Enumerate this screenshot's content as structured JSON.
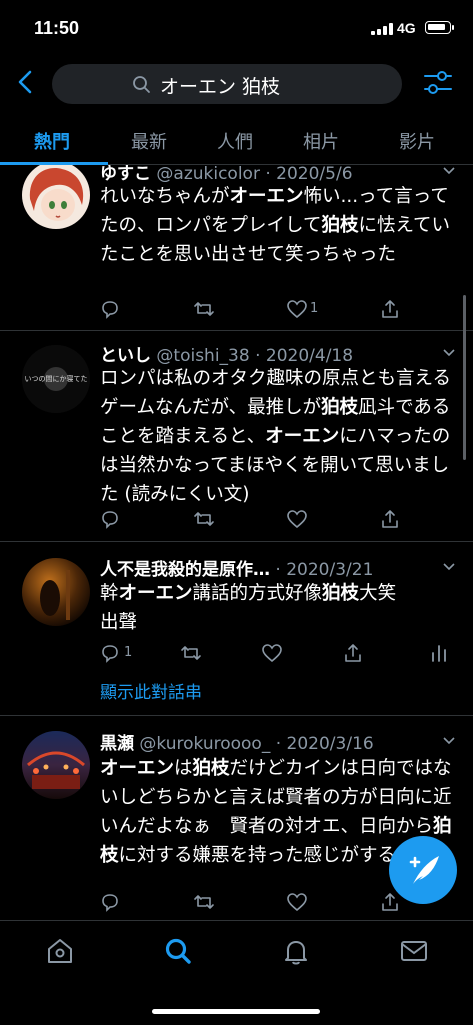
{
  "status": {
    "time": "11:50",
    "network": "4G"
  },
  "header": {
    "query": "オーエン 狛枝"
  },
  "tabs": [
    "熱門",
    "最新",
    "人們",
    "相片",
    "影片"
  ],
  "tweets": [
    {
      "name": "ゆすこ",
      "meta": "@azukicolor · 2020/5/6",
      "body": "れいなちゃんがオーエン怖い...って言ってたの、ロンパをプレイして狛枝に怯えていたことを思い出させて笑っちゃった",
      "like_count": "1"
    },
    {
      "name": "といし",
      "meta": "@toishi_38 · 2020/4/18",
      "avatar_text": "いつの間にか寝てた",
      "body": "ロンパは私のオタク趣味の原点とも言えるゲームなんだが、最推しが狛枝凪斗であることを踏まえると、オーエンにハマったのは当然かなってまほやくを開いて思いました (読みにくい文)"
    },
    {
      "name": "人不是我殺的是原作…",
      "meta": "· 2020/3/21",
      "body": "幹オーエン講話的方式好像狛枝大笑出聲",
      "reply_count": "1",
      "thread": "顯示此對話串"
    },
    {
      "name": "黒瀬",
      "meta": "@kurokuroooo_ · 2020/3/16",
      "body": "オーエンは狛枝だけどカインは日向ではないしどちらかと言えば賢者の方が日向に近いんだよなぁ　賢者の対オエ、日向から狛枝に対する嫌悪を持った感じがする　アイランド日向"
    }
  ],
  "icons": {
    "back": "back-arrow-icon",
    "search": "search-icon",
    "filter": "filter-sliders-icon",
    "compose": "compose-feather-icon",
    "nav": [
      "home-icon",
      "search-icon",
      "notifications-bell-icon",
      "messages-mail-icon"
    ]
  },
  "colors": {
    "accent": "#1d9bf0",
    "background": "#000000",
    "muted": "#8b98a5"
  }
}
